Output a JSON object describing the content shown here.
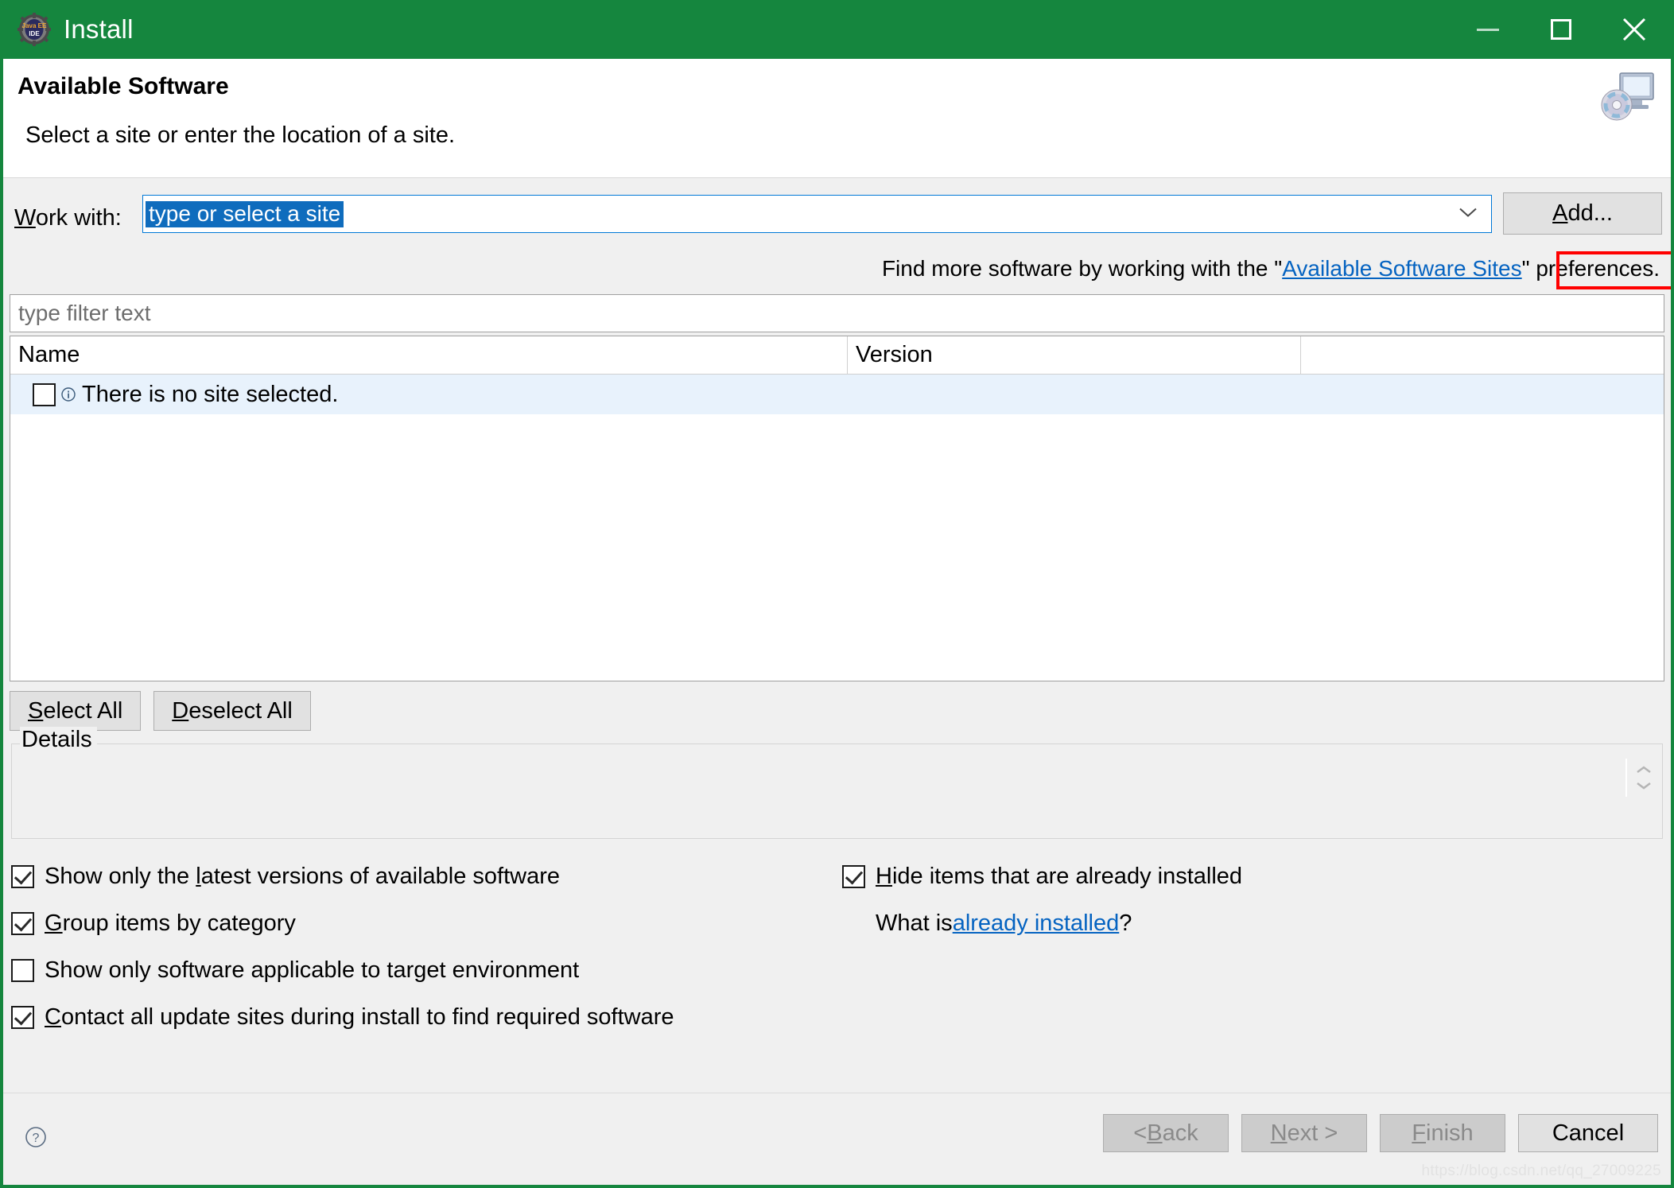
{
  "window": {
    "title": "Install",
    "app_icon": "eclipse-javaee-ide-icon",
    "titlebar_color": "#15863E",
    "controls": {
      "minimize": "minimize-icon",
      "maximize": "maximize-icon",
      "close": "close-icon"
    }
  },
  "header": {
    "title": "Available Software",
    "subtitle": "Select a site or enter the location of a site.",
    "icon": "monitor-with-disc-icon"
  },
  "work_with": {
    "label_prefix": "W",
    "label_rest": "ork with:",
    "combo_value": "type or select a site",
    "combo_caret": "chevron-down-icon",
    "add_button_prefix": "A",
    "add_button_rest": "dd..."
  },
  "find_more": {
    "prefix": "Find more software by working with the \"",
    "link": "Available Software Sites",
    "suffix": "\" preferences.",
    "highlight_color": "#ff0000",
    "link_color": "#0563c1"
  },
  "filter": {
    "placeholder": "type filter text",
    "value": ""
  },
  "table": {
    "columns": [
      "Name",
      "Version",
      ""
    ],
    "rows": [
      {
        "checked": false,
        "icon": "info-icon",
        "name": "There is no site selected.",
        "version": ""
      }
    ]
  },
  "selection_buttons": {
    "select_all_prefix": "S",
    "select_all_rest": "elect All",
    "deselect_all_prefix": "D",
    "deselect_all_rest": "eselect All"
  },
  "details": {
    "legend": "Details",
    "body": "",
    "spinner_up": "chevron-up-icon",
    "spinner_down": "chevron-down-icon"
  },
  "options": {
    "left": [
      {
        "checked": true,
        "pre": "Show only the ",
        "accel": "l",
        "post": "atest versions of available software"
      },
      {
        "checked": true,
        "pre": "",
        "accel": "G",
        "post": "roup items by category"
      },
      {
        "checked": false,
        "pre": "",
        "accel": "",
        "post": "Show only software applicable to target environment"
      },
      {
        "checked": true,
        "pre": "",
        "accel": "C",
        "post": "ontact all update sites during install to find required software"
      }
    ],
    "right": [
      {
        "checked": true,
        "pre": "",
        "accel": "H",
        "post": "ide items that are already installed"
      }
    ],
    "what_is_prefix": "What is ",
    "what_is_link": "already installed",
    "what_is_suffix": "?"
  },
  "footer": {
    "help_icon": "help-question-icon",
    "buttons": [
      {
        "name": "back",
        "prefix": "< ",
        "accel": "B",
        "rest": "ack",
        "enabled": false
      },
      {
        "name": "next",
        "prefix": "",
        "accel": "N",
        "rest": "ext >",
        "enabled": false
      },
      {
        "name": "finish",
        "prefix": "",
        "accel": "F",
        "rest": "inish",
        "enabled": false
      },
      {
        "name": "cancel",
        "prefix": "",
        "accel": "",
        "rest": "Cancel",
        "enabled": true
      }
    ],
    "watermark": "https://blog.csdn.net/qq_27009225"
  }
}
